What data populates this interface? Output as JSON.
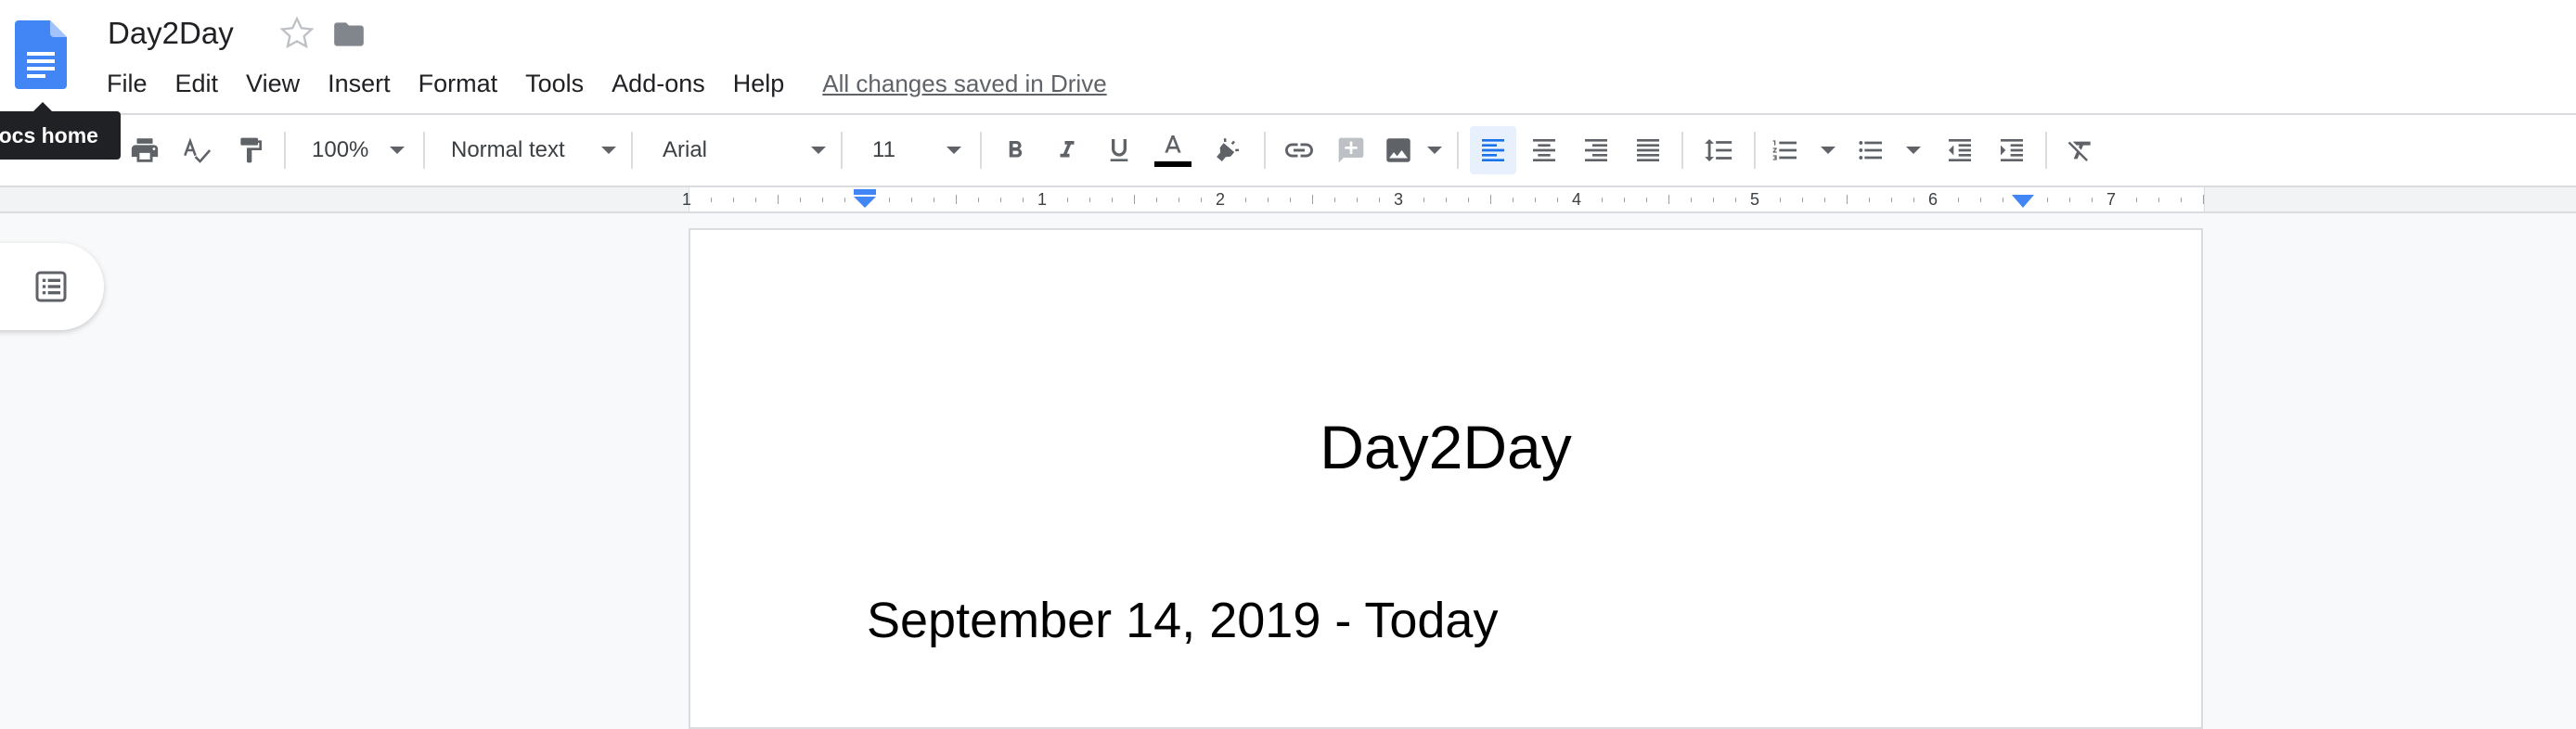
{
  "app": {
    "doc_title": "Day2Day",
    "tooltip": "Docs home",
    "menu": [
      "File",
      "Edit",
      "View",
      "Insert",
      "Format",
      "Tools",
      "Add-ons",
      "Help"
    ],
    "saved_status": "All changes saved in Drive"
  },
  "toolbar": {
    "zoom": "100%",
    "style": "Normal text",
    "font": "Arial",
    "font_size": "11",
    "text_color": "#000000",
    "active_alignment": "left",
    "icons": [
      "print-icon",
      "spellcheck-icon",
      "paint-format-icon",
      "bold-icon",
      "italic-icon",
      "underline-icon",
      "text-color-icon",
      "highlight-icon",
      "link-icon",
      "comment-icon",
      "image-icon",
      "align-left-icon",
      "align-center-icon",
      "align-right-icon",
      "align-justify-icon",
      "line-spacing-icon",
      "numbered-list-icon",
      "bulleted-list-icon",
      "decrease-indent-icon",
      "increase-indent-icon",
      "clear-formatting-icon"
    ]
  },
  "ruler": {
    "labels": [
      "1",
      "1",
      "2",
      "3",
      "4",
      "5",
      "6",
      "7"
    ]
  },
  "document": {
    "heading": "Day2Day",
    "date_line": "September 14, 2019 - Today"
  },
  "colors": {
    "accent": "#4285f4",
    "active_bg": "#e8f0fe",
    "tooltip_bg": "#202124"
  }
}
